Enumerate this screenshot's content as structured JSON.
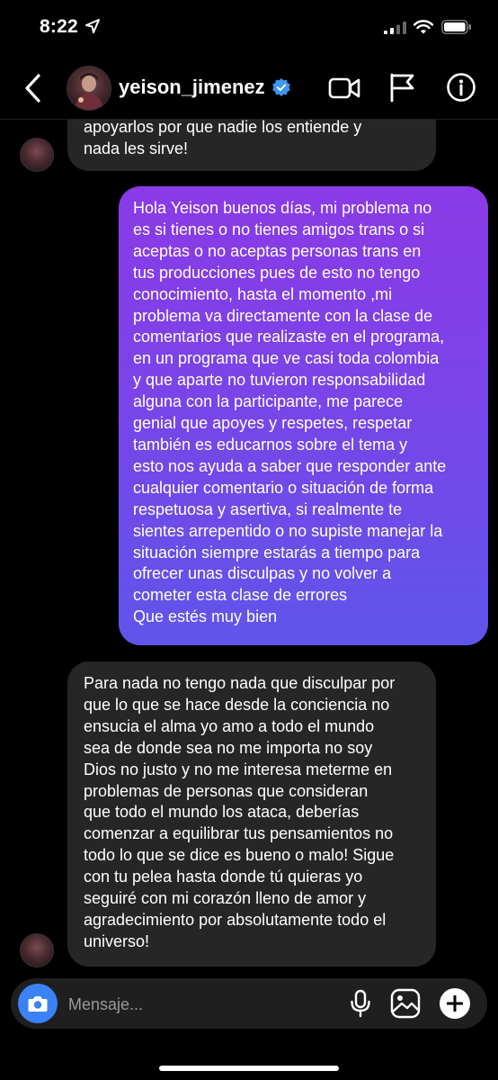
{
  "status_bar": {
    "time": "8:22"
  },
  "header": {
    "username": "yeison_jimenez"
  },
  "messages": [
    {
      "direction": "incoming",
      "text": "apoyarlos por que nadie los entiende y\nnada les sirve!"
    },
    {
      "direction": "outgoing",
      "text": "Hola Yeison buenos días, mi problema no\nes si tienes o no tienes amigos trans o si\naceptas o no aceptas personas trans en\ntus producciones pues de esto no tengo\nconocimiento, hasta el momento ,mi\nproblema va directamente con la clase de\ncomentarios que realizaste en el programa,\nen un programa que ve casi toda colombia\ny que aparte no tuvieron responsabilidad\nalguna con la participante, me parece\ngenial que apoyes y respetes, respetar\ntambién es  educarnos sobre el tema y\nesto nos ayuda a saber que responder ante\ncualquier comentario o situación de forma\nrespetuosa y asertiva, si realmente te\nsientes arrepentido o no supiste manejar la\nsituación siempre estarás a tiempo para\nofrecer unas disculpas y no volver a\ncometer esta clase de errores\nQue estés muy bien"
    },
    {
      "direction": "incoming",
      "text": "Para nada no tengo nada que disculpar por\nque lo que se hace desde la conciencia no\nensucia el alma yo amo a todo el mundo\nsea de donde sea no me importa no soy\nDios no justo y no me interesa meterme en\nproblemas de personas que consideran\nque todo el mundo los ataca, deberías\ncomenzar a equilibrar tus pensamientos no\ntodo lo que se dice es bueno o malo! Sigue\ncon tu pelea hasta donde tú quieras yo\nseguiré con mi corazón lleno de amor y\nagradecimiento por absolutamente todo el\nuniverso!"
    }
  ],
  "composer": {
    "placeholder": "Mensaje..."
  },
  "icons": {
    "status": [
      "location-arrow-icon",
      "signal-icon",
      "wifi-icon",
      "battery-icon"
    ],
    "header": [
      "back-chevron-icon",
      "verified-badge-icon",
      "video-call-icon",
      "flag-icon",
      "info-icon"
    ],
    "composer": [
      "camera-icon",
      "microphone-icon",
      "gallery-icon",
      "plus-icon"
    ]
  },
  "colors": {
    "background": "#000000",
    "incoming_bubble": "#262626",
    "outgoing_gradient_top": "#8a3ae6",
    "outgoing_gradient_bottom": "#5f55ea",
    "verified": "#3b97f0",
    "camera_button": "#3b82f6"
  }
}
